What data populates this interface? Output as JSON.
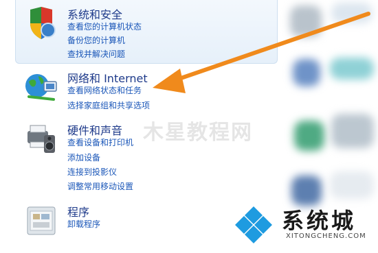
{
  "categories": [
    {
      "title": "系统和安全",
      "links": [
        "查看您的计算机状态",
        "备份您的计算机",
        "查找并解决问题"
      ]
    },
    {
      "title": "网络和 Internet",
      "links": [
        "查看网络状态和任务",
        "选择家庭组和共享选项"
      ]
    },
    {
      "title": "硬件和声音",
      "links": [
        "查看设备和打印机",
        "添加设备",
        "连接到投影仪",
        "调整常用移动设置"
      ]
    },
    {
      "title": "程序",
      "links": [
        "卸载程序"
      ]
    }
  ],
  "watermark_center": "木星教程网",
  "logo": {
    "brand": "系统城",
    "domain": "XITONGCHENG.COM"
  },
  "colors": {
    "arrow": "#f08a1c",
    "link": "#1a56b8",
    "title": "#1e3a8a",
    "logo_blue": "#1e9be0"
  }
}
